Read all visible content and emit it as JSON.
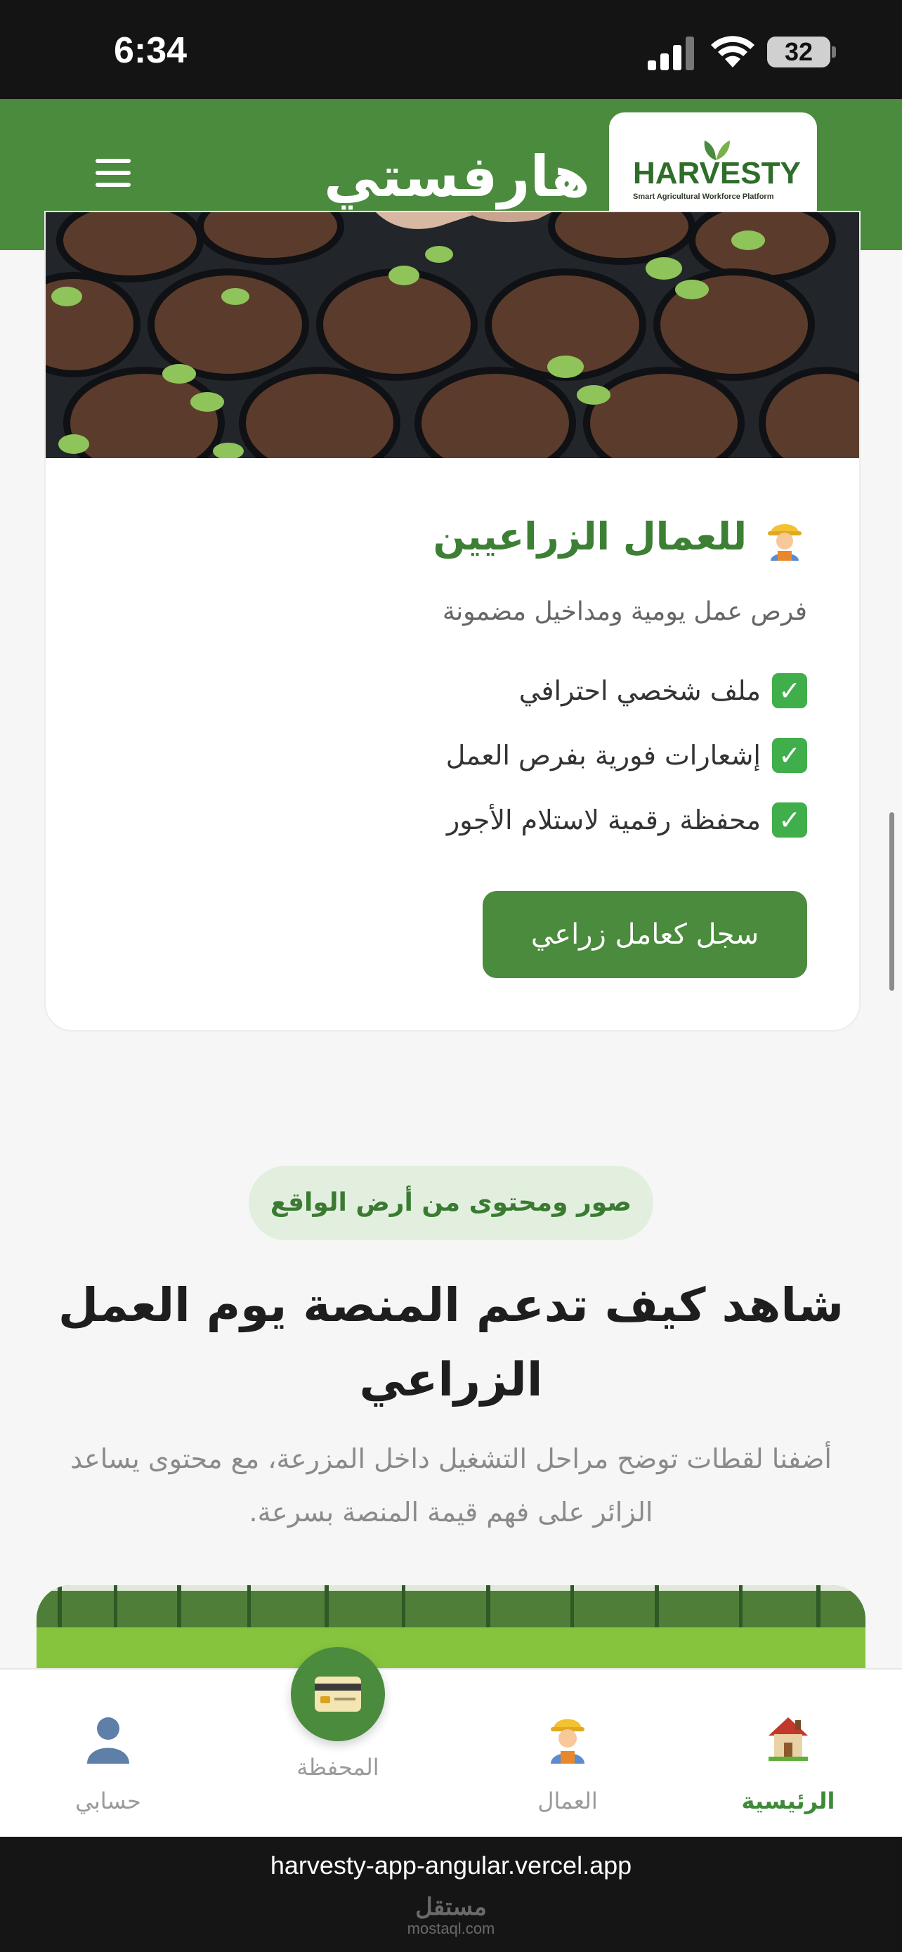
{
  "status_bar": {
    "time": "6:34",
    "battery": "32"
  },
  "header": {
    "brand_name": "هارفستي",
    "logo_text": "HARVESTY",
    "logo_subtitle": "Smart Agricultural Workforce Platform",
    "menu_icon": "hamburger-icon"
  },
  "card": {
    "title": "للعمال الزراعيين",
    "title_icon": "farmer-emoji-icon",
    "subtitle": "فرص عمل يومية ومداخيل مضمونة",
    "features": [
      "ملف شخصي احترافي",
      "إشعارات فورية بفرص العمل",
      "محفظة رقمية لاستلام الأجور"
    ],
    "button_label": "سجل كعامل زراعي"
  },
  "section": {
    "pill_label": "صور ومحتوى من أرض الواقع",
    "title": "شاهد كيف تدعم المنصة يوم العمل الزراعي",
    "description": "أضفنا لقطات توضح مراحل التشغيل داخل المزرعة، مع محتوى يساعد الزائر على فهم قيمة المنصة بسرعة."
  },
  "bottom_nav": {
    "items": [
      {
        "label": "الرئيسية",
        "icon": "house-icon",
        "active": true
      },
      {
        "label": "العمال",
        "icon": "farmer-icon",
        "active": false
      },
      {
        "label": "المحفظة",
        "icon": "credit-card-icon",
        "active": false
      },
      {
        "label": "حسابي",
        "icon": "user-silhouette-icon",
        "active": false
      }
    ]
  },
  "browser": {
    "url": "harvesty-app-angular.vercel.app",
    "watermark": "مستقل",
    "watermark_sub": "mostaql.com"
  },
  "colors": {
    "primary": "#4a8b3d",
    "check": "#3fae4b",
    "pill_bg": "#e2efdf"
  }
}
